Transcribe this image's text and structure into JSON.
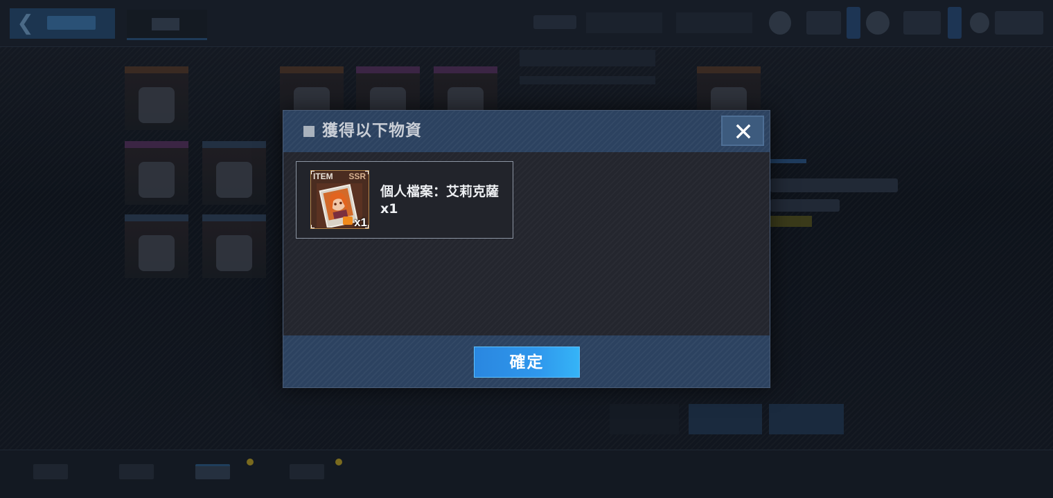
{
  "modal": {
    "title": "獲得以下物資",
    "close_icon": "close-icon",
    "confirm_label": "確定"
  },
  "reward": {
    "type_label": "ITEM",
    "rarity_label": "SSR",
    "quantity_label": "x1",
    "name": "個人檔案：艾莉克薩x1",
    "art_icon": "character-portrait-icon"
  },
  "colors": {
    "header_bg": "#2c4260",
    "body_bg": "#24262e",
    "confirm_button": "#2f97ec",
    "close_button": "#3d5b7e",
    "icon_frame": "#b9894c"
  }
}
